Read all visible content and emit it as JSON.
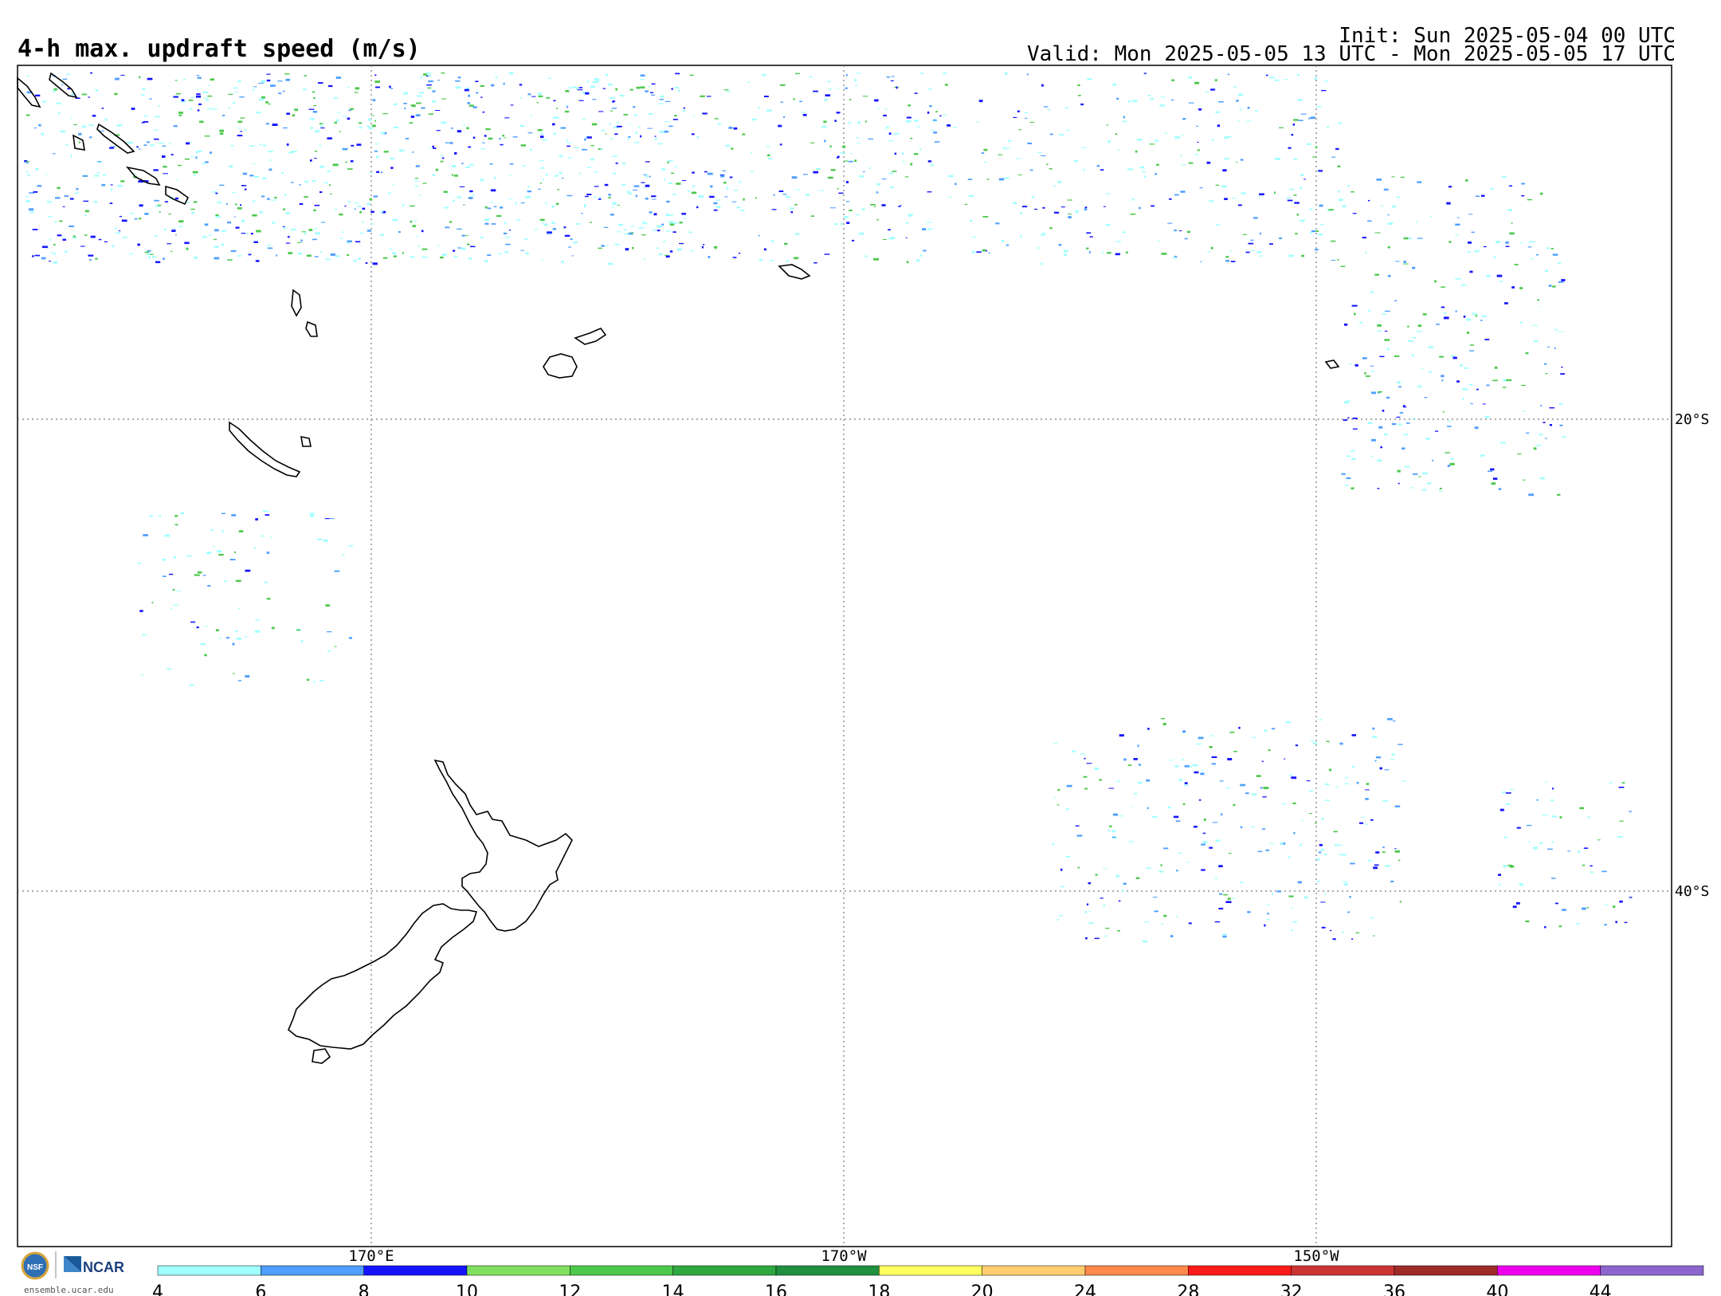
{
  "title": "4-h max. updraft speed (m/s)",
  "init": "Init: Sun 2025-05-04 00 UTC",
  "valid": "Valid: Mon 2025-05-05 13 UTC - Mon 2025-05-05 17 UTC",
  "lat_labels": [
    "20°S",
    "40°S"
  ],
  "lon_labels": [
    "170°E",
    "170°W",
    "150°W"
  ],
  "colorbar": {
    "ticks": [
      "4",
      "6",
      "8",
      "10",
      "12",
      "14",
      "16",
      "18",
      "20",
      "24",
      "28",
      "32",
      "36",
      "40",
      "44"
    ],
    "colors": [
      "#a0ffff",
      "#4f9fff",
      "#1414ff",
      "#7fe05f",
      "#4cc84c",
      "#2fa83f",
      "#208f3f",
      "#ffff60",
      "#ffcd70",
      "#ff8a4c",
      "#ff1a1a",
      "#cc3333",
      "#9f2a2a",
      "#ee00ee",
      "#8c66cc"
    ]
  },
  "logos": {
    "nsf": "NSF",
    "ncar": "NCAR",
    "site": "ensemble.ucar.edu"
  },
  "icons": {
    "nsf_logo": "nsf-globe-logo",
    "ncar_logo": "ncar-logo"
  }
}
